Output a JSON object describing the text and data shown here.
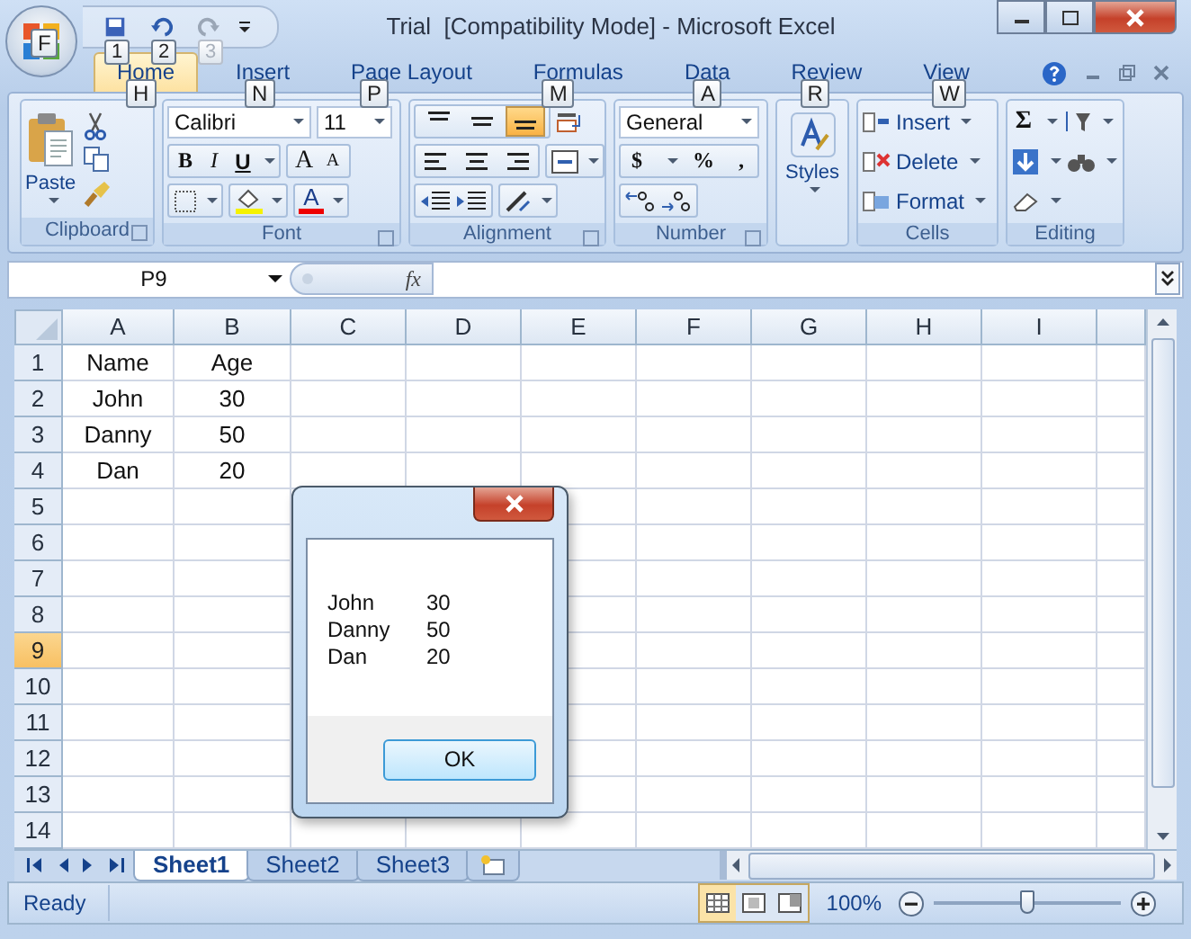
{
  "window": {
    "title": "Trial  [Compatibility Mode] - Microsoft Excel"
  },
  "office_button": {
    "keytip": "F"
  },
  "quick_access": [
    {
      "keytip": "1",
      "disabled": false
    },
    {
      "keytip": "2",
      "disabled": false
    },
    {
      "keytip": "3",
      "disabled": true
    }
  ],
  "tabs": [
    {
      "label": "Home",
      "selected": true,
      "keytip": "H"
    },
    {
      "label": "Insert",
      "selected": false,
      "keytip": "N"
    },
    {
      "label": "Page Layout",
      "selected": false,
      "keytip": "P"
    },
    {
      "label": "Formulas",
      "selected": false,
      "keytip": "M"
    },
    {
      "label": "Data",
      "selected": false,
      "keytip": "A"
    },
    {
      "label": "Review",
      "selected": false,
      "keytip": "R"
    },
    {
      "label": "View",
      "selected": false,
      "keytip": "W"
    }
  ],
  "ribbon": {
    "clipboard": {
      "paste": "Paste",
      "label": "Clipboard"
    },
    "font": {
      "name": "Calibri",
      "size": "11",
      "bold": "B",
      "italic": "I",
      "underline": "U",
      "grow": "A",
      "shrink": "A",
      "color_button": "A",
      "label": "Font"
    },
    "alignment": {
      "vertical": [
        {
          "selected": false
        },
        {
          "selected": false
        },
        {
          "selected": true
        }
      ],
      "label": "Alignment"
    },
    "number": {
      "format": "General",
      "currency": "$",
      "percent": "%",
      "comma": ",",
      "label": "Number"
    },
    "styles": {
      "label": "Styles"
    },
    "cells": {
      "buttons": [
        "Insert",
        "Delete",
        "Format"
      ],
      "label": "Cells"
    },
    "editing": {
      "sum": "Σ",
      "label": "Editing"
    }
  },
  "formula_bar": {
    "name_box": "P9",
    "fx": "fx"
  },
  "sheet": {
    "columns": [
      "A",
      "B",
      "C",
      "D",
      "E",
      "F",
      "G",
      "H",
      "I"
    ],
    "rows": [
      {
        "label": "1",
        "selected": false,
        "cells": [
          "Name",
          "Age"
        ]
      },
      {
        "label": "2",
        "selected": false,
        "cells": [
          "John",
          "30"
        ]
      },
      {
        "label": "3",
        "selected": false,
        "cells": [
          "Danny",
          "50"
        ]
      },
      {
        "label": "4",
        "selected": false,
        "cells": [
          "Dan",
          "20"
        ]
      },
      {
        "label": "5",
        "selected": false
      },
      {
        "label": "6",
        "selected": false
      },
      {
        "label": "7",
        "selected": false
      },
      {
        "label": "8",
        "selected": false
      },
      {
        "label": "9",
        "selected": true
      },
      {
        "label": "10",
        "selected": false
      },
      {
        "label": "11",
        "selected": false
      },
      {
        "label": "12",
        "selected": false
      },
      {
        "label": "13",
        "selected": false
      },
      {
        "label": "14",
        "selected": false
      }
    ]
  },
  "dialog": {
    "rows": [
      [
        "John",
        "30"
      ],
      [
        "Danny",
        "50"
      ],
      [
        "Dan",
        "20"
      ]
    ],
    "button": "OK"
  },
  "sheet_tabs": [
    {
      "label": "Sheet1",
      "selected": true
    },
    {
      "label": "Sheet2",
      "selected": false
    },
    {
      "label": "Sheet3",
      "selected": false
    }
  ],
  "status_bar": {
    "text": "Ready",
    "views": [
      {
        "selected": true
      },
      {
        "selected": false
      },
      {
        "selected": false
      }
    ],
    "zoom": "100%",
    "zoom_slider": {
      "level": 0.5
    }
  }
}
